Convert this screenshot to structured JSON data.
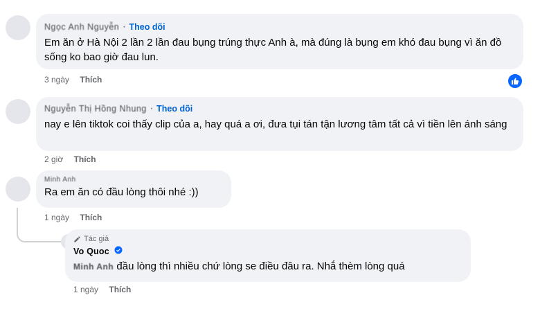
{
  "comments": [
    {
      "name": "Ngọc Anh Nguyễn",
      "follow": "Theo dõi",
      "text": "Em ăn ở Hà Nội 2 lần 2 lần đau bụng trúng thực Anh à, mà đúng là bụng em khó đau bụng vì ăn đồ sống ko bao giờ đau lun.",
      "time": "3 ngày",
      "like": "Thích"
    },
    {
      "name": "Nguyễn Thị Hồng Nhung",
      "follow": "Theo dõi",
      "text": "nay e lên tiktok coi thấy clip của a, hay quá a ơi, đưa tụi tán tận lương tâm tất cả vì tiền lên ánh sáng",
      "time": "2 giờ",
      "like": "Thích"
    },
    {
      "name": "Minh Anh",
      "text": "Ra em ăn có đầu lòng thôi nhé :))",
      "time": "1 ngày",
      "like": "Thích"
    }
  ],
  "reply": {
    "author_tag": "Tác giả",
    "name": "Vo Quoc",
    "mention": "Minh Anh",
    "text": "đầu lòng thì nhiều chứ lòng se điều đâu ra. Nhắ thèm lòng quá",
    "time": "1 ngày",
    "like": "Thích"
  },
  "icons": {
    "reaction": "thumbs-up-icon",
    "verified": "verified-badge-icon",
    "author": "pen-icon"
  },
  "colors": {
    "follow": "#0064d1",
    "reaction": "#0866ff",
    "bubble": "#f0f2f5"
  }
}
